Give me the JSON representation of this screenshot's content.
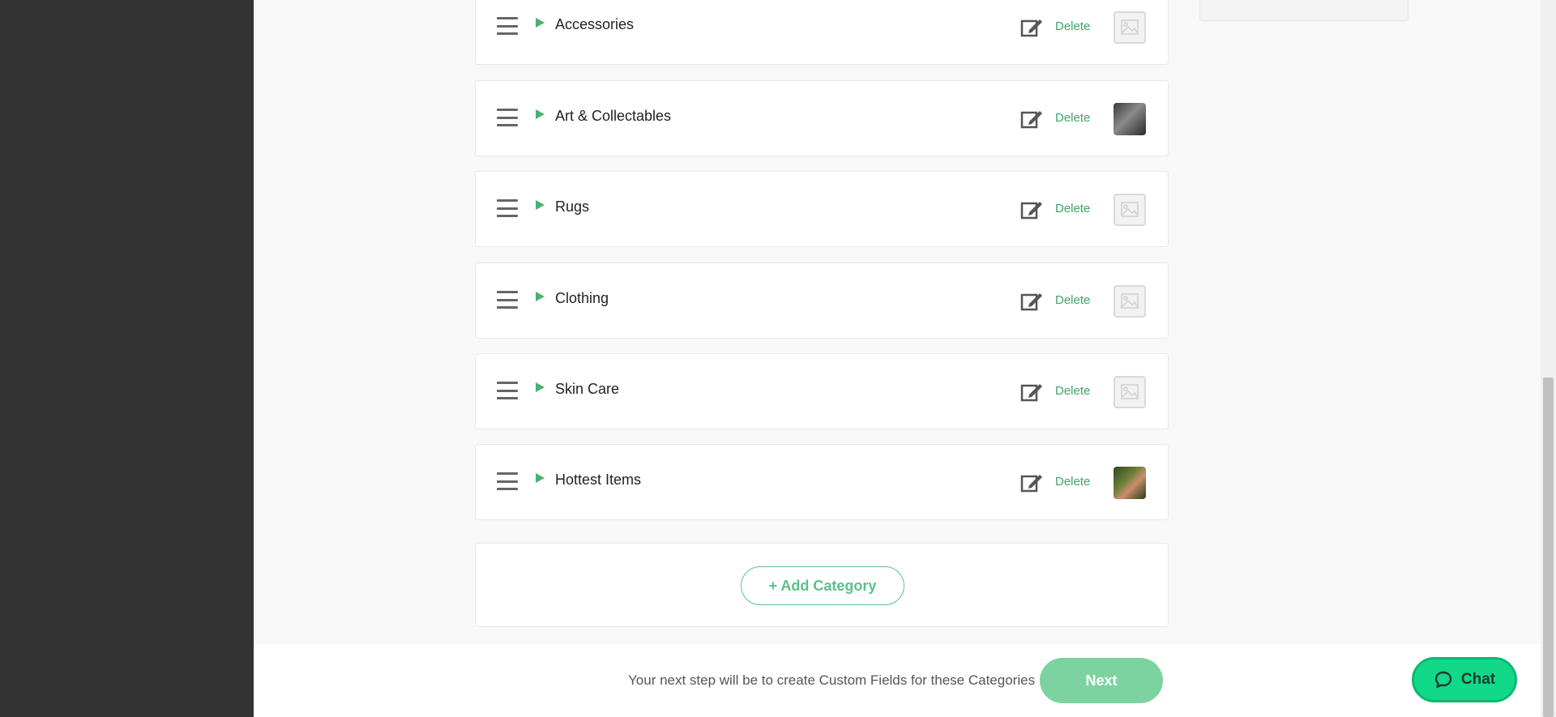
{
  "categories": [
    {
      "label": "Accessories",
      "delete_label": "Delete",
      "has_image": false
    },
    {
      "label": "Art & Collectables",
      "delete_label": "Delete",
      "has_image": true
    },
    {
      "label": "Rugs",
      "delete_label": "Delete",
      "has_image": false
    },
    {
      "label": "Clothing",
      "delete_label": "Delete",
      "has_image": false
    },
    {
      "label": "Skin Care",
      "delete_label": "Delete",
      "has_image": false
    },
    {
      "label": "Hottest Items",
      "delete_label": "Delete",
      "has_image": true
    }
  ],
  "add_category_label": "+ Add Category",
  "footer": {
    "next_step_text": "Your next step will be to create Custom Fields for these Categories",
    "next_label": "Next"
  },
  "chat": {
    "label": "Chat"
  },
  "icons": {
    "drag": "drag-handle-icon",
    "expand": "expand-caret-icon",
    "edit": "edit-icon",
    "placeholder": "image-placeholder-icon",
    "chat": "chat-bubble-icon"
  },
  "colors": {
    "accent": "#4caf6e",
    "delete_link": "#3fa565",
    "next_button": "#7dd3a0",
    "chat_button": "#12d98a",
    "sidebar": "#333333"
  }
}
